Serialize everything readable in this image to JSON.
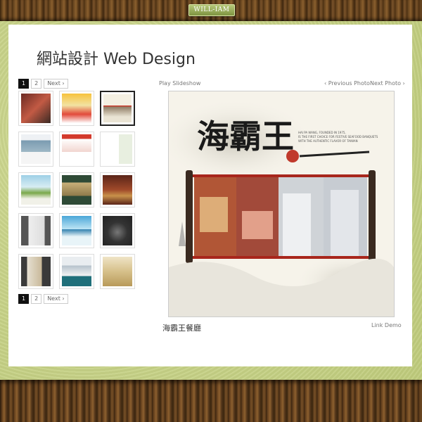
{
  "brand": {
    "logo_text": "WILL-IAM"
  },
  "page": {
    "title": "網站設計 Web Design"
  },
  "pager_top": {
    "pages": [
      "1",
      "2"
    ],
    "next": "Next ›"
  },
  "pager_bottom": {
    "pages": [
      "1",
      "2"
    ],
    "next": "Next ›"
  },
  "controls": {
    "play_slideshow": "Play Slideshow",
    "previous_photo": "‹ Previous Photo",
    "next_photo": "Next Photo ›"
  },
  "photo": {
    "brand_text": "海霸王",
    "tagline": "HAI PA WANG, FOUNDED IN 1975, IS THE FIRST CHOICE FOR FESTIVE SEAFOOD BANQUETS WITH THE AUTHENTIC FLAVOR OF TAIWAN"
  },
  "caption": {
    "title": "海霸王餐廳",
    "link": "Link Demo"
  }
}
